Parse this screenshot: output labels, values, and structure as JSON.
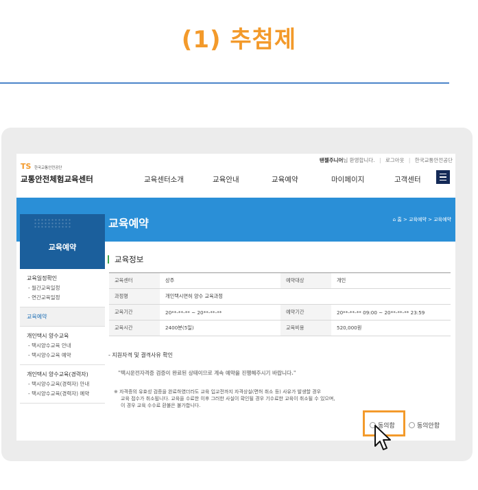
{
  "heading": "(1) 추첨제",
  "site": {
    "logo_mark": "TS",
    "logo_sub": "한국교통안전공단",
    "logo_name": "교통안전체험교육센터",
    "util": {
      "user": "탠젤주니어",
      "greeting": "님 환영합니다.",
      "logout": "로그아웃",
      "org": "한국교통안전공단"
    },
    "nav": [
      "교육센터소개",
      "교육안내",
      "교육예약",
      "마이페이지",
      "고객센터"
    ]
  },
  "banner": {
    "title": "교육예약",
    "breadcrumb": [
      "홈",
      "교육예약",
      "교육예약"
    ]
  },
  "sidebar": {
    "title": "교육예약",
    "groups": [
      {
        "label": "교육일정확인",
        "subs": [
          "- 월간교육일정",
          "- 연간교육일정"
        ]
      },
      {
        "label": "교육예약",
        "subs": []
      },
      {
        "label": "개인택시 양수교육",
        "subs": [
          "- 택시양수교육 안내",
          "- 택시양수교육 예약"
        ]
      },
      {
        "label": "개인택시 양수교육(경력자)",
        "subs": [
          "- 택시양수교육(경력자) 안내",
          "- 택시양수교육(경력자) 예약"
        ]
      }
    ]
  },
  "content": {
    "section_title": "교육정보",
    "table": {
      "r1": {
        "k1": "교육센터",
        "v1": "상주",
        "k2": "예약대상",
        "v2": "개인"
      },
      "r2": {
        "k1": "과정명",
        "v1": "개인택시면허 양수 교육과정"
      },
      "r3": {
        "k1": "교육기간",
        "v1": "20**-**-** ~ 20**-**-**",
        "k2": "예약기간",
        "v2": "20**-**-** 09:00 ~ 20**-**-** 23:59"
      },
      "r4": {
        "k1": "교육시간",
        "v1": "2400분(5일)",
        "k2": "교육비용",
        "v2": "520,000원"
      }
    },
    "requirement": "- 지원자격 및 결격사유 확인",
    "notice": "\"택시운전자격증 검증이 완료된 상태이므로 계속 예약을 진행해주시기 바랍니다.\"",
    "warning": [
      "※ 자격증의 유효성 검증을 완료하였더라도 교육 입교전까지 자격상실(면허 취소 등) 사유가 발생할 경우",
      "교육 접수가 취소됩니다. 교육을 수료한 이후 그러한 사실이 확인될 경우 기수료한 교육이 취소될 수 있으며,",
      "이 경우 교육 수수료 환불은 불가합니다."
    ],
    "agree": "동의함",
    "disagree": "동의안함"
  },
  "colors": {
    "accent": "#f39a2b",
    "banner": "#2a8fd7",
    "sidebar_head": "#1b5f9c"
  }
}
